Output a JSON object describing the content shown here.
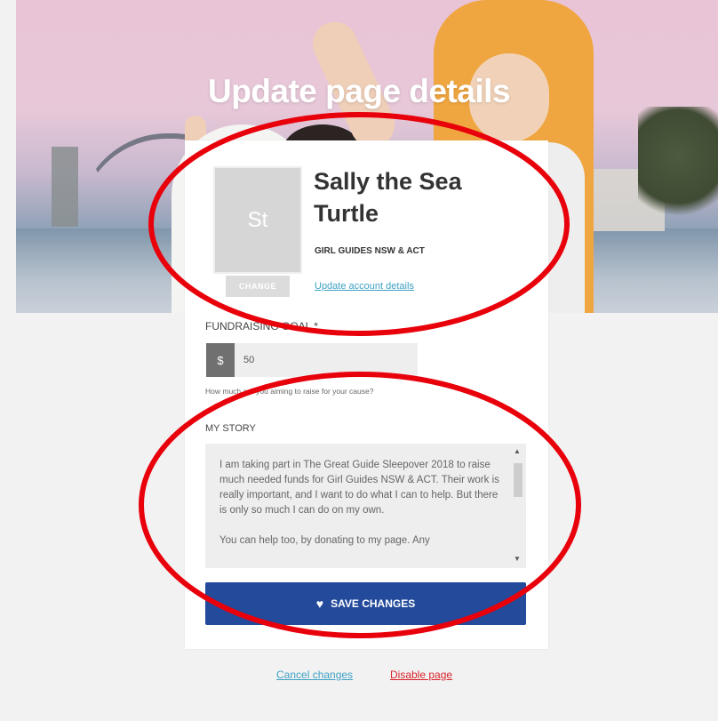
{
  "page": {
    "title": "Update page details"
  },
  "profile": {
    "avatar_initials": "St",
    "name": "Sally the Sea Turtle",
    "organisation": "GIRL GUIDES NSW & ACT",
    "change_label": "CHANGE",
    "update_account_label": "Update account details"
  },
  "goal": {
    "label": "FUNDRAISING GOAL *",
    "currency": "$",
    "value": "50",
    "help": "How much are you aiming to raise for your cause?"
  },
  "story": {
    "label": "MY STORY",
    "text": "I am taking part in The Great Guide Sleepover 2018 to raise much needed funds for Girl Guides NSW & ACT. Their work is really important, and I want to do what I can to help. But there is only so much I can do on my own.\n\nYou can help too, by donating to my page. Any"
  },
  "actions": {
    "save_label": "SAVE CHANGES",
    "cancel_label": "Cancel changes",
    "disable_label": "Disable page"
  },
  "colors": {
    "primary": "#234a9b",
    "link": "#3ea1c4",
    "danger": "#d8232a",
    "annotation": "#e8000b"
  },
  "icons": {
    "save": "heart-icon",
    "scroll_up": "arrow-up-icon",
    "scroll_down": "arrow-down-icon"
  }
}
